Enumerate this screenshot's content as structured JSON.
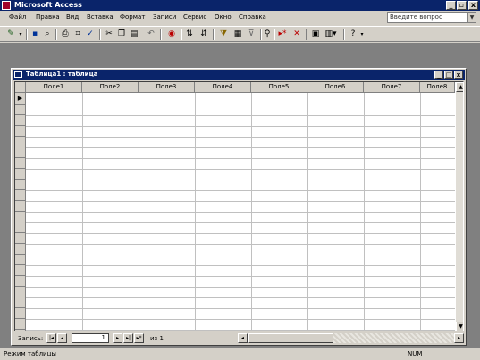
{
  "app": {
    "title": "Microsoft Access",
    "min": "_",
    "max": "▫",
    "close": "x"
  },
  "menu": [
    "Файл",
    "Правка",
    "Вид",
    "Вставка",
    "Формат",
    "Записи",
    "Сервис",
    "Окно",
    "Справка"
  ],
  "ask_question": {
    "placeholder": "Введите вопрос"
  },
  "child_window": {
    "title": "Таблица1 : таблица",
    "min": "_",
    "max": "□",
    "close": "x"
  },
  "grid": {
    "columns": [
      "Поле1",
      "Поле2",
      "Поле3",
      "Поле4",
      "Поле5",
      "Поле6",
      "Поле7",
      "Поле8"
    ],
    "current_row_marker": "▶"
  },
  "navigation": {
    "label": "Запись:",
    "current": "1",
    "total_text": "из 1"
  },
  "status": {
    "left": "Режим таблицы",
    "right": "NUM"
  },
  "icons": [
    "view-icon",
    "save-icon",
    "print-icon",
    "preview-icon",
    "spelling-icon",
    "cut-icon",
    "copy-icon",
    "paste-icon",
    "undo-icon",
    "sort-asc-icon",
    "sort-desc-icon",
    "filter-icon",
    "find-icon",
    "new-record-icon",
    "delete-record-icon",
    "database-window-icon",
    "new-object-icon",
    "help-icon"
  ]
}
